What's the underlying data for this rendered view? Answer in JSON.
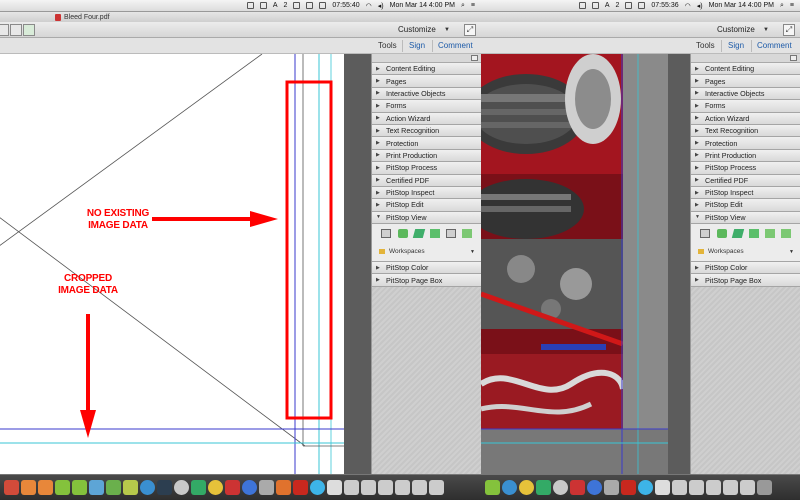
{
  "left": {
    "menubar": {
      "time": "07:55:40",
      "date": "Mon Mar 14  4:00 PM",
      "n2": "2"
    },
    "window_title": "Bleed Four.pdf",
    "toolbar": {
      "customize_label": "Customize"
    },
    "tabs": [
      "Tools",
      "Sign",
      "Comment"
    ],
    "annotations": {
      "no_existing_line1": "NO EXISTING",
      "no_existing_line2": "IMAGE DATA",
      "cropped_line1": "CROPPED",
      "cropped_line2": "IMAGE DATA"
    }
  },
  "right": {
    "menubar": {
      "time": "07:55:36",
      "date": "Mon Mar 14  4:00 PM",
      "n2": "2"
    },
    "toolbar": {
      "customize_label": "Customize"
    },
    "tabs": [
      "Tools",
      "Sign",
      "Comment"
    ]
  },
  "panel": {
    "sections": [
      "Content Editing",
      "Pages",
      "Interactive Objects",
      "Forms",
      "Action Wizard",
      "Text Recognition",
      "Protection",
      "Print Production",
      "PitStop Process",
      "Certified PDF",
      "PitStop Inspect",
      "PitStop Edit",
      "PitStop View"
    ],
    "workspaces_label": "Workspaces",
    "bottom_sections": [
      "PitStop Color",
      "PitStop Page Box"
    ]
  },
  "colors": {
    "annotation_red": "#ff0000",
    "tab_blue": "#1c5aa8",
    "guide_cyan": "#38c6d6",
    "guide_blue": "#3a3acc"
  },
  "dock_icons": [
    "finder-icon",
    "calc-icon",
    "calc-icon",
    "publisher-icon",
    "publisher-icon",
    "photo-icon",
    "sync-icon",
    "browser-icon",
    "safari-icon",
    "x-icon",
    "compass-icon",
    "app-icon",
    "chrome-icon",
    "gear-icon",
    "firefox-icon",
    "ftp-icon",
    "globe-icon",
    "doc-icon",
    "doc-icon",
    "folder-icon",
    "folder-icon",
    "trash-icon"
  ]
}
